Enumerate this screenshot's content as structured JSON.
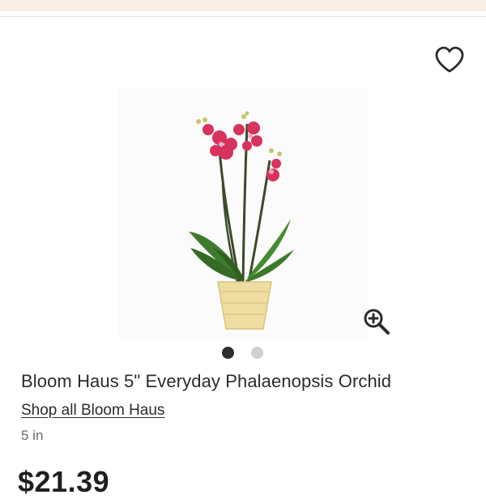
{
  "header": {
    "banner_color": "#f7efe6"
  },
  "product": {
    "title": "Bloom Haus 5\" Everyday Phalaenopsis Orchid",
    "brand_link": "Shop all Bloom Haus",
    "size": "5 in",
    "price": "$21.39",
    "image": {
      "description_icon": "orchid-plant-photo",
      "dots": 2,
      "active_dot": 0
    },
    "favorite_icon": "heart-outline-icon",
    "zoom_icon": "zoom-in-icon"
  },
  "colors": {
    "text": "#2b2b2b",
    "muted": "#6a6a6a",
    "dot_active": "#2f2f33",
    "dot_inactive": "#cfd0d4"
  }
}
